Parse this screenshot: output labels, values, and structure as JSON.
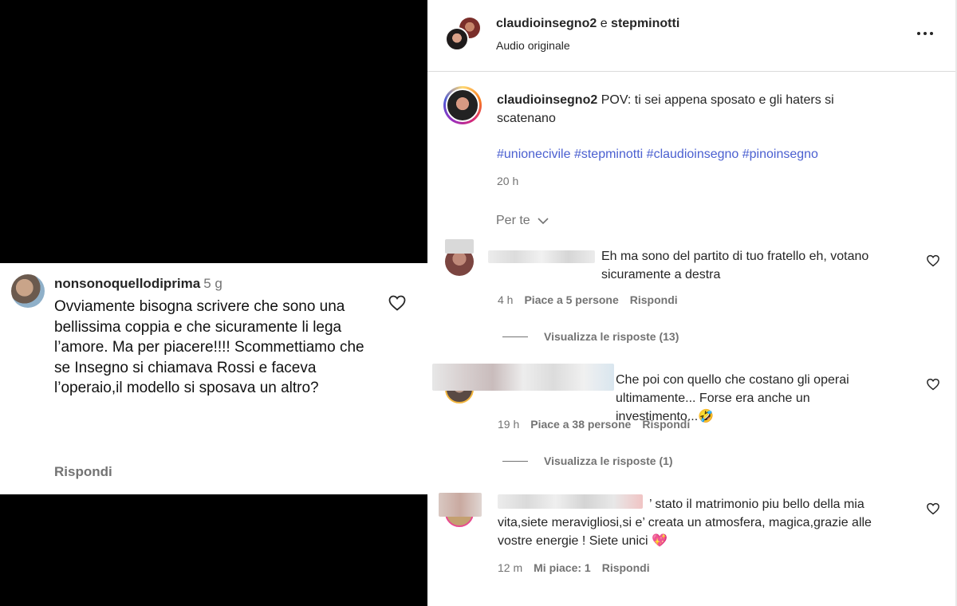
{
  "left_comment": {
    "username": "nonsonoquellodiprima",
    "time": "5 g",
    "text": "Ovviamente bisogna scrivere che sono una bellissima coppia e che sicuramente li lega l’amore. Ma per piacere!!!! Scommettiamo che se Insegno si chiamava Rossi e faceva l’operaio,il modello si sposava un altro?",
    "reply": "Rispondi"
  },
  "header": {
    "user1": "claudioinsegno2",
    "connector": " e ",
    "user2": "stepminotti",
    "subtitle": "Audio originale"
  },
  "caption": {
    "username": "claudioinsegno2",
    "text": "POV: ti sei appena sposato e gli haters si scatenano",
    "hashtags": "#unionecivile #stepminotti #claudioinsegno #pinoinsegno",
    "time": "20 h"
  },
  "filter": {
    "label": "Per te"
  },
  "comments": [
    {
      "text": "Eh ma sono del partito di tuo fratello eh, votano sicuramente a destra",
      "time": "4 h",
      "likes": "Piace a 5 persone",
      "reply": "Rispondi",
      "view_replies": "Visualizza le risposte (13)"
    },
    {
      "text": "Che poi con quello che costano gli operai ultimamente... Forse era anche un investimento...🤣",
      "time": "19 h",
      "likes": "Piace a 38 persone",
      "reply": "Rispondi",
      "view_replies": "Visualizza le risposte (1)"
    },
    {
      "text": "’ stato il matrimonio piu bello della mia vita,siete meravigliosi,si e’ creata un atmosfera, magica,grazie alle vostre energie ! Siete unici 💖",
      "time": "12 m",
      "likes": "Mi piace: 1",
      "reply": "Rispondi"
    }
  ],
  "colors": {
    "hashtag": "#4a5fd0",
    "muted": "#737373",
    "text": "#262626"
  },
  "icons": [
    "heart-icon",
    "more-options-icon",
    "chevron-down-icon"
  ]
}
